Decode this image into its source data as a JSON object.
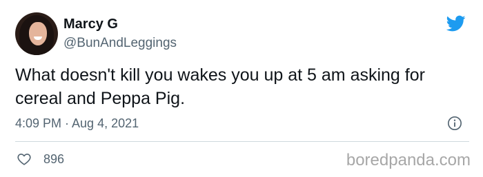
{
  "tweet": {
    "author_name": "Marcy G",
    "author_handle": "@BunAndLeggings",
    "text": "What doesn't kill you wakes you up at 5 am asking for cereal and Peppa Pig.",
    "timestamp": "4:09 PM · Aug 4, 2021",
    "like_count": "896"
  },
  "icons": {
    "avatar": "profile-photo",
    "brand": "twitter-bird-icon",
    "info": "info-icon",
    "like": "heart-icon"
  },
  "colors": {
    "brand_blue": "#1d9bf0",
    "secondary_text": "#536471",
    "primary_text": "#0f1419",
    "divider": "#cfd9de",
    "watermark": "#a7a7a7"
  },
  "watermark": {
    "text": "boredpanda.com"
  }
}
